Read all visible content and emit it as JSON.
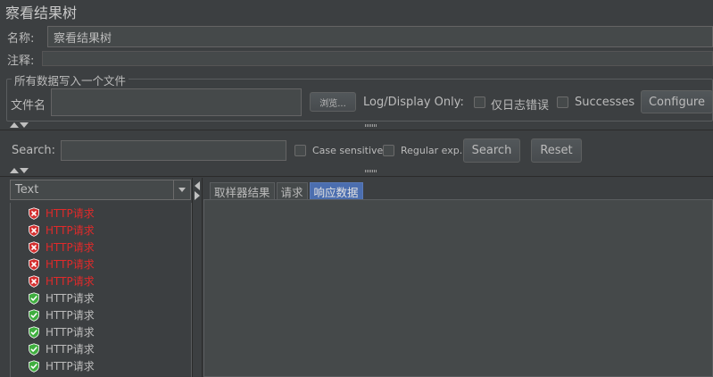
{
  "window": {
    "title": "察看结果树"
  },
  "form": {
    "name_label": "名称:",
    "name_value": "察看结果树",
    "comment_label": "注释:",
    "comment_value": ""
  },
  "file_group": {
    "legend": "所有数据写入一个文件",
    "filename_label": "文件名",
    "filename_value": "",
    "browse_label": "浏览...",
    "log_display_label": "Log/Display Only:",
    "errors_only_label": "仅日志错误",
    "successes_label": "Successes",
    "configure_label": "Configure"
  },
  "search": {
    "label": "Search:",
    "value": "",
    "case_sensitive_label": "Case sensitive",
    "regex_label": "Regular exp.",
    "search_button": "Search",
    "reset_button": "Reset"
  },
  "renderer": {
    "selected": "Text"
  },
  "tree": {
    "items": [
      {
        "label": "HTTP请求",
        "status": "error"
      },
      {
        "label": "HTTP请求",
        "status": "error"
      },
      {
        "label": "HTTP请求",
        "status": "error"
      },
      {
        "label": "HTTP请求",
        "status": "error"
      },
      {
        "label": "HTTP请求",
        "status": "error"
      },
      {
        "label": "HTTP请求",
        "status": "success"
      },
      {
        "label": "HTTP请求",
        "status": "success"
      },
      {
        "label": "HTTP请求",
        "status": "success"
      },
      {
        "label": "HTTP请求",
        "status": "success"
      },
      {
        "label": "HTTP请求",
        "status": "success"
      }
    ]
  },
  "tabs": [
    {
      "label": "取样器结果",
      "active": false
    },
    {
      "label": "请求",
      "active": false
    },
    {
      "label": "响应数据",
      "active": true
    }
  ],
  "colors": {
    "background": "#3c3f41",
    "error_text": "#e02a2a",
    "error_icon": "#d32f2f",
    "success_icon": "#3fae3f",
    "active_tab": "#4b6eaf"
  }
}
